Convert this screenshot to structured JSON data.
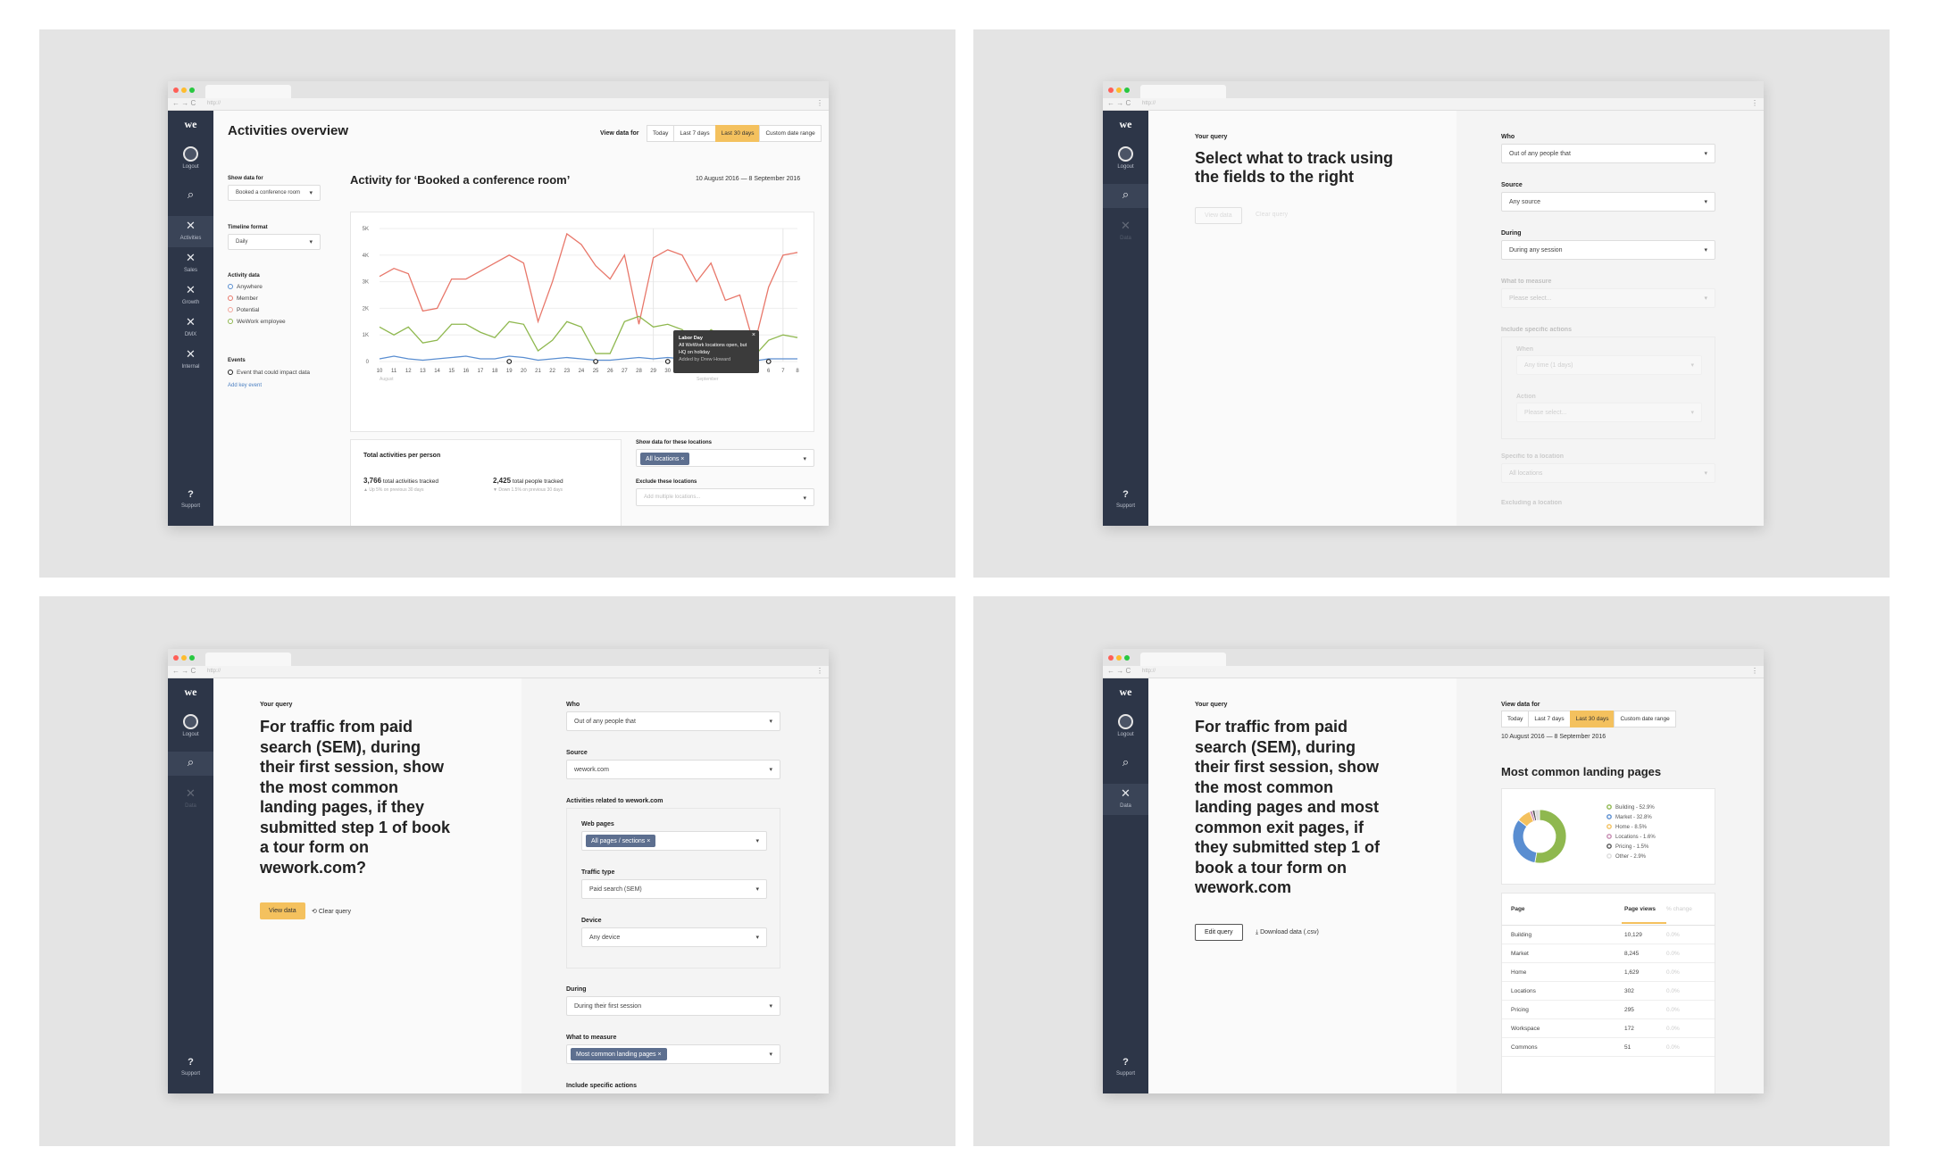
{
  "browser": {
    "url": "http://",
    "nav": "← → C",
    "menu": "⋮"
  },
  "sidebar": {
    "logo": "we",
    "logout": "Logout",
    "support": "Support",
    "support_icon": "?",
    "search_icon": "⌕",
    "close_icon": "✕",
    "nav_full": [
      "Activities",
      "Sales",
      "Growth",
      "DMX",
      "Internal"
    ],
    "nav_data": "Data"
  },
  "panel1": {
    "title": "Activities overview",
    "view_data_for": "View data for",
    "ranges": [
      "Today",
      "Last 7 days",
      "Last 30 days",
      "Custom date range"
    ],
    "active_range": "Last 30 days",
    "show_data_for": "Show data for",
    "show_data_value": "Booked a conference room",
    "timeline_format": "Timeline format",
    "timeline_value": "Daily",
    "activity_data": "Activity data",
    "legend": [
      "Anywhere",
      "Member",
      "Potential",
      "WeWork employee"
    ],
    "events": "Events",
    "event_item": "Event that could impact data",
    "add_event": "Add key event",
    "chart_title": "Activity for ‘Booked a conference room’",
    "date_range": "10 August 2016 — 8 September 2016",
    "tooltip": {
      "title": "Labor Day",
      "body_1": "All WeWork locations open, but",
      "body_2": "HQ on holiday",
      "added_by": "Added by Drew Howard",
      "close": "×"
    },
    "month_labels": [
      "August",
      "September"
    ],
    "total_title": "Total activities per person",
    "stat1_value": "3,766",
    "stat1_label": "total activities tracked",
    "stat1_sub": "▲ Up 5% on previous 30 days",
    "stat2_value": "2,425",
    "stat2_label": "total people tracked",
    "stat2_sub": "▼ Down 1.5% on previous 30 days",
    "locations_label": "Show data for these locations",
    "locations_chip": "All locations",
    "exclude_label": "Exclude these locations",
    "exclude_placeholder": "Add multiple locations..."
  },
  "panel2": {
    "your_query": "Your query",
    "query_line1": "Select what to track using",
    "query_line2": "the fields to the right",
    "view_data": "View data",
    "clear_query": "Clear query",
    "who": "Who",
    "who_value": "Out of any people that",
    "source": "Source",
    "source_value": "Any source",
    "during": "During",
    "during_value": "During any session",
    "what_to_measure": "What to measure",
    "please_select": "Please select...",
    "include_actions": "Include specific actions",
    "when": "When",
    "when_value": "Any time (1 days)",
    "action": "Action",
    "specific_location": "Specific to a location",
    "all_locations": "All locations",
    "excluding_location": "Excluding a location"
  },
  "panel3": {
    "your_query": "Your query",
    "query_lines": [
      "For traffic from paid",
      "search (SEM), during",
      "their first session, show",
      "the most common",
      "landing pages, if they",
      "submitted step 1 of book",
      "a tour form on",
      "wework.com?"
    ],
    "view_data": "View data",
    "clear_query": "Clear query",
    "who": "Who",
    "who_value": "Out of any people that",
    "source": "Source",
    "source_value": "wework.com",
    "activities_related": "Activities related to wework.com",
    "web_pages": "Web pages",
    "web_pages_chip": "All pages / sections",
    "traffic_type": "Traffic type",
    "traffic_value": "Paid search (SEM)",
    "device": "Device",
    "device_value": "Any device",
    "during": "During",
    "during_value": "During their first session",
    "what_to_measure": "What to measure",
    "measure_chip": "Most common landing pages",
    "include_actions": "Include specific actions"
  },
  "panel4": {
    "your_query": "Your query",
    "query_lines": [
      "For traffic from paid",
      "search (SEM), during",
      "their first session, show",
      "the most common",
      "landing pages and most",
      "common exit pages, if",
      "they submitted step 1 of",
      "book a tour form on",
      "wework.com"
    ],
    "edit_query": "Edit query",
    "download": "Download data (.csv)",
    "view_data_for": "View data for",
    "ranges": [
      "Today",
      "Last 7 days",
      "Last 30 days",
      "Custom date range"
    ],
    "date_range": "10 August 2016 — 8 September 2016",
    "section_title": "Most common landing pages",
    "table_headers": [
      "Page",
      "Page views",
      "% change"
    ],
    "table_rows": [
      [
        "Building",
        "10,129",
        "0.0%"
      ],
      [
        "Market",
        "8,245",
        "0.0%"
      ],
      [
        "Home",
        "1,629",
        "0.0%"
      ],
      [
        "Locations",
        "302",
        "0.0%"
      ],
      [
        "Pricing",
        "295",
        "0.0%"
      ],
      [
        "Workspace",
        "172",
        "0.0%"
      ],
      [
        "Commons",
        "51",
        "0.0%"
      ]
    ]
  },
  "chart_data": [
    {
      "type": "line",
      "title": "Activity for ‘Booked a conference room’",
      "categories": [
        "10",
        "11",
        "12",
        "13",
        "14",
        "15",
        "16",
        "17",
        "18",
        "19",
        "20",
        "21",
        "22",
        "23",
        "24",
        "25",
        "26",
        "27",
        "28",
        "29",
        "30",
        "31",
        "1",
        "2",
        "3",
        "4",
        "5",
        "6",
        "7",
        "8"
      ],
      "ylim": [
        0,
        5000
      ],
      "yticks": [
        "0",
        "1K",
        "2K",
        "3K",
        "4K",
        "5K"
      ],
      "grid": true,
      "series": [
        {
          "name": "Member",
          "color": "#e8776a",
          "values": [
            3200,
            3500,
            3300,
            1900,
            2000,
            3100,
            3100,
            3400,
            3700,
            4000,
            3700,
            1500,
            3000,
            4800,
            4400,
            3600,
            3100,
            4000,
            1400,
            3900,
            4200,
            4000,
            3000,
            3700,
            2300,
            2500,
            600,
            2800,
            4000,
            4100
          ]
        },
        {
          "name": "WeWork employee",
          "color": "#8fb84f",
          "values": [
            1300,
            1000,
            1300,
            700,
            800,
            1400,
            1400,
            1100,
            900,
            1500,
            1400,
            400,
            800,
            1500,
            1300,
            300,
            300,
            1500,
            1700,
            1300,
            1400,
            1200,
            700,
            1200,
            900,
            600,
            200,
            800,
            1000,
            900
          ]
        },
        {
          "name": "Anywhere",
          "color": "#5a8ed1",
          "values": [
            100,
            200,
            100,
            50,
            100,
            150,
            200,
            100,
            100,
            200,
            150,
            50,
            100,
            150,
            100,
            50,
            50,
            100,
            150,
            100,
            150,
            100,
            50,
            100,
            100,
            50,
            20,
            100,
            100,
            100
          ]
        }
      ],
      "event_markers": [
        "19",
        "25",
        "30",
        "5",
        "6"
      ]
    },
    {
      "type": "pie",
      "title": "Most common landing pages",
      "series": [
        {
          "name": "Building - 52.9%",
          "value": 52.9,
          "color": "#8fb84f"
        },
        {
          "name": "Market - 32.8%",
          "value": 32.8,
          "color": "#5a8ed1"
        },
        {
          "name": "Home - 8.5%",
          "value": 8.5,
          "color": "#f4c15e"
        },
        {
          "name": "Locations - 1.6%",
          "value": 1.6,
          "color": "#c58ab0"
        },
        {
          "name": "Pricing - 1.5%",
          "value": 1.5,
          "color": "#555555"
        },
        {
          "name": "Other - 2.9%",
          "value": 2.9,
          "color": "#dddddd"
        }
      ]
    }
  ]
}
